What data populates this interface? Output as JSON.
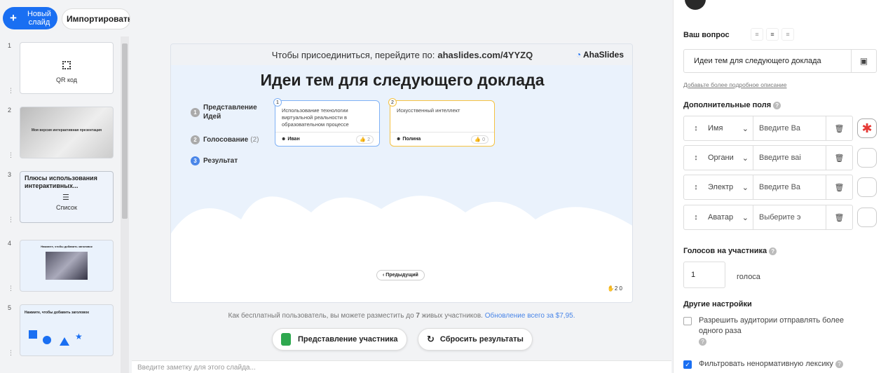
{
  "toolbar": {
    "new_slide": "Новый слайд",
    "import": "Импортировать"
  },
  "slides": [
    {
      "num": "1",
      "label": "QR код"
    },
    {
      "num": "2",
      "label": "Моя версия интерактивная презентация"
    },
    {
      "num": "3",
      "label": "Плюсы использования интерактивных...",
      "sub": "Список"
    },
    {
      "num": "4",
      "label": "Нажмите, чтобы добавить заголовок"
    },
    {
      "num": "5",
      "label": "Нажмите, чтобы добавить заголовок"
    }
  ],
  "slide": {
    "join_text": "Чтобы присоединиться, перейдите по:",
    "join_url": "ahaslides.com/4YYZQ",
    "brand": "AhaSlides",
    "title": "Идеи тем для следующего доклада",
    "steps": [
      {
        "num": "1",
        "label": "Представление Идей"
      },
      {
        "num": "2",
        "label": "Голосование",
        "extra": "(2)"
      },
      {
        "num": "3",
        "label": "Результат"
      }
    ],
    "cards": [
      {
        "idx": "1",
        "text": "Использование технологии виртуальной реальности в образовательном процессе",
        "author": "Иван",
        "likes": "2",
        "color": "#7fb1f5"
      },
      {
        "idx": "2",
        "text": "Искусственный интеллект",
        "author": "Полина",
        "likes": "0",
        "color": "#f5c242"
      }
    ],
    "prev_btn": "‹ Предыдущий",
    "stats": "2 0"
  },
  "info": {
    "text": "Как бесплатный пользователь, вы можете разместить до",
    "count": "7",
    "text2": "живых участников.",
    "link": "Обновление всего за $7,95."
  },
  "buttons": {
    "participant_view": "Представление участника",
    "reset": "Сбросить результаты"
  },
  "notes_placeholder": "Введите заметку для этого слайда...",
  "panel": {
    "question_label": "Ваш вопрос",
    "question_value": "Идеи тем для следующего доклада",
    "desc_link": "Добавьте более подробное описание",
    "extra_fields_label": "Дополнительные поля",
    "fields": [
      {
        "type": "Имя",
        "placeholder": "Введите Ва",
        "required": true
      },
      {
        "type": "Органи",
        "placeholder": "Введите ваі",
        "required": false
      },
      {
        "type": "Электр",
        "placeholder": "Введите Ва",
        "required": false
      },
      {
        "type": "Аватар",
        "placeholder": "Выберите э",
        "required": false
      }
    ],
    "votes_label": "Голосов на участника",
    "votes_value": "1",
    "votes_unit": "голоса",
    "other_label": "Другие настройки",
    "opt_multi": "Разрешить аудитории отправлять более одного раза",
    "opt_filter": "Фильтровать ненормативную лексику"
  }
}
